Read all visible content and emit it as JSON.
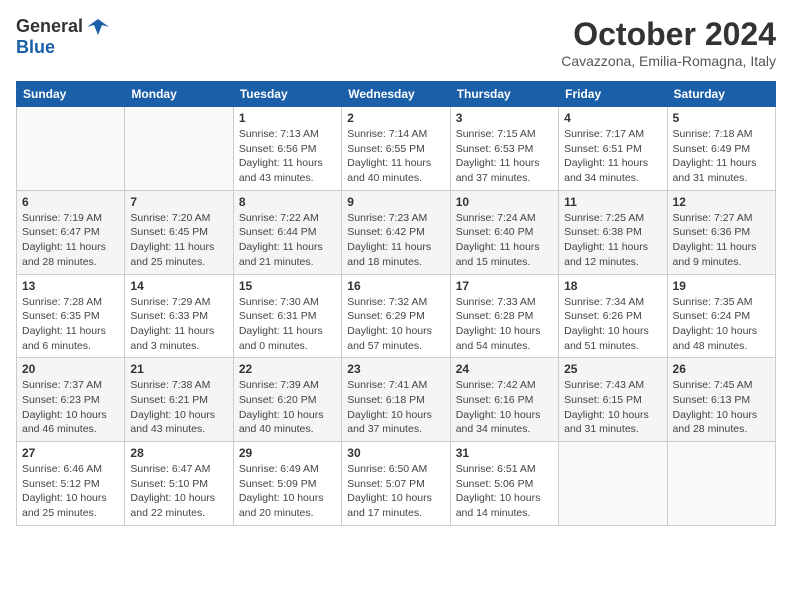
{
  "header": {
    "logo_general": "General",
    "logo_blue": "Blue",
    "month_title": "October 2024",
    "location": "Cavazzona, Emilia-Romagna, Italy"
  },
  "weekdays": [
    "Sunday",
    "Monday",
    "Tuesday",
    "Wednesday",
    "Thursday",
    "Friday",
    "Saturday"
  ],
  "weeks": [
    [
      {
        "day": "",
        "info": ""
      },
      {
        "day": "",
        "info": ""
      },
      {
        "day": "1",
        "info": "Sunrise: 7:13 AM\nSunset: 6:56 PM\nDaylight: 11 hours and 43 minutes."
      },
      {
        "day": "2",
        "info": "Sunrise: 7:14 AM\nSunset: 6:55 PM\nDaylight: 11 hours and 40 minutes."
      },
      {
        "day": "3",
        "info": "Sunrise: 7:15 AM\nSunset: 6:53 PM\nDaylight: 11 hours and 37 minutes."
      },
      {
        "day": "4",
        "info": "Sunrise: 7:17 AM\nSunset: 6:51 PM\nDaylight: 11 hours and 34 minutes."
      },
      {
        "day": "5",
        "info": "Sunrise: 7:18 AM\nSunset: 6:49 PM\nDaylight: 11 hours and 31 minutes."
      }
    ],
    [
      {
        "day": "6",
        "info": "Sunrise: 7:19 AM\nSunset: 6:47 PM\nDaylight: 11 hours and 28 minutes."
      },
      {
        "day": "7",
        "info": "Sunrise: 7:20 AM\nSunset: 6:45 PM\nDaylight: 11 hours and 25 minutes."
      },
      {
        "day": "8",
        "info": "Sunrise: 7:22 AM\nSunset: 6:44 PM\nDaylight: 11 hours and 21 minutes."
      },
      {
        "day": "9",
        "info": "Sunrise: 7:23 AM\nSunset: 6:42 PM\nDaylight: 11 hours and 18 minutes."
      },
      {
        "day": "10",
        "info": "Sunrise: 7:24 AM\nSunset: 6:40 PM\nDaylight: 11 hours and 15 minutes."
      },
      {
        "day": "11",
        "info": "Sunrise: 7:25 AM\nSunset: 6:38 PM\nDaylight: 11 hours and 12 minutes."
      },
      {
        "day": "12",
        "info": "Sunrise: 7:27 AM\nSunset: 6:36 PM\nDaylight: 11 hours and 9 minutes."
      }
    ],
    [
      {
        "day": "13",
        "info": "Sunrise: 7:28 AM\nSunset: 6:35 PM\nDaylight: 11 hours and 6 minutes."
      },
      {
        "day": "14",
        "info": "Sunrise: 7:29 AM\nSunset: 6:33 PM\nDaylight: 11 hours and 3 minutes."
      },
      {
        "day": "15",
        "info": "Sunrise: 7:30 AM\nSunset: 6:31 PM\nDaylight: 11 hours and 0 minutes."
      },
      {
        "day": "16",
        "info": "Sunrise: 7:32 AM\nSunset: 6:29 PM\nDaylight: 10 hours and 57 minutes."
      },
      {
        "day": "17",
        "info": "Sunrise: 7:33 AM\nSunset: 6:28 PM\nDaylight: 10 hours and 54 minutes."
      },
      {
        "day": "18",
        "info": "Sunrise: 7:34 AM\nSunset: 6:26 PM\nDaylight: 10 hours and 51 minutes."
      },
      {
        "day": "19",
        "info": "Sunrise: 7:35 AM\nSunset: 6:24 PM\nDaylight: 10 hours and 48 minutes."
      }
    ],
    [
      {
        "day": "20",
        "info": "Sunrise: 7:37 AM\nSunset: 6:23 PM\nDaylight: 10 hours and 46 minutes."
      },
      {
        "day": "21",
        "info": "Sunrise: 7:38 AM\nSunset: 6:21 PM\nDaylight: 10 hours and 43 minutes."
      },
      {
        "day": "22",
        "info": "Sunrise: 7:39 AM\nSunset: 6:20 PM\nDaylight: 10 hours and 40 minutes."
      },
      {
        "day": "23",
        "info": "Sunrise: 7:41 AM\nSunset: 6:18 PM\nDaylight: 10 hours and 37 minutes."
      },
      {
        "day": "24",
        "info": "Sunrise: 7:42 AM\nSunset: 6:16 PM\nDaylight: 10 hours and 34 minutes."
      },
      {
        "day": "25",
        "info": "Sunrise: 7:43 AM\nSunset: 6:15 PM\nDaylight: 10 hours and 31 minutes."
      },
      {
        "day": "26",
        "info": "Sunrise: 7:45 AM\nSunset: 6:13 PM\nDaylight: 10 hours and 28 minutes."
      }
    ],
    [
      {
        "day": "27",
        "info": "Sunrise: 6:46 AM\nSunset: 5:12 PM\nDaylight: 10 hours and 25 minutes."
      },
      {
        "day": "28",
        "info": "Sunrise: 6:47 AM\nSunset: 5:10 PM\nDaylight: 10 hours and 22 minutes."
      },
      {
        "day": "29",
        "info": "Sunrise: 6:49 AM\nSunset: 5:09 PM\nDaylight: 10 hours and 20 minutes."
      },
      {
        "day": "30",
        "info": "Sunrise: 6:50 AM\nSunset: 5:07 PM\nDaylight: 10 hours and 17 minutes."
      },
      {
        "day": "31",
        "info": "Sunrise: 6:51 AM\nSunset: 5:06 PM\nDaylight: 10 hours and 14 minutes."
      },
      {
        "day": "",
        "info": ""
      },
      {
        "day": "",
        "info": ""
      }
    ]
  ]
}
